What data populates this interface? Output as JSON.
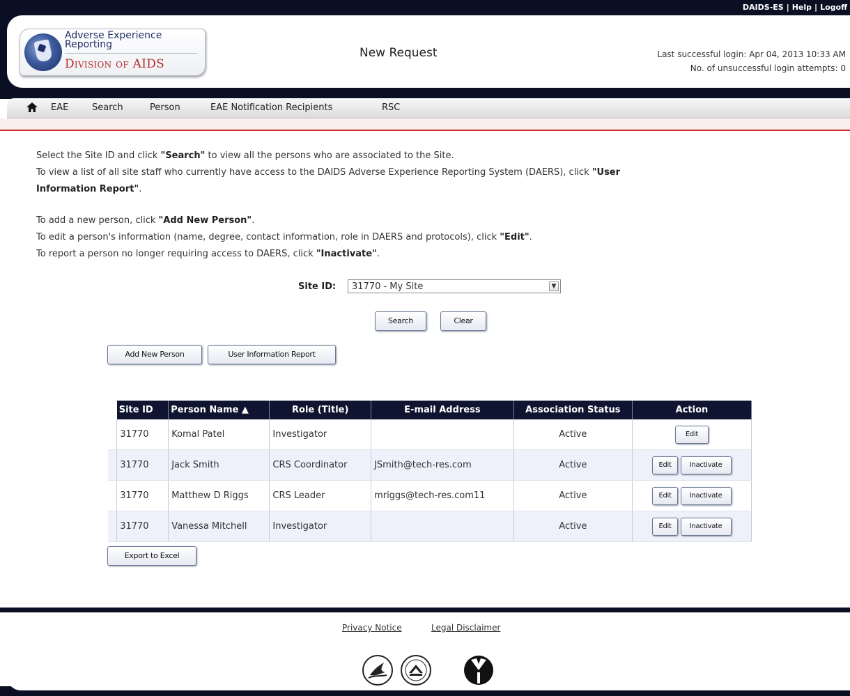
{
  "header": {
    "top_links": [
      "DAIDS-ES",
      "Help",
      "Logoff"
    ],
    "logo": {
      "line1": "Adverse Experience",
      "line2": "Reporting",
      "org": "Division of AIDS"
    },
    "page_title": "New Request",
    "last_login": "Last successful login: Apr 04, 2013 10:33 AM",
    "failed_attempts": "No. of unsuccessful login attempts: 0"
  },
  "nav": {
    "home_icon": "home-icon",
    "items": [
      "EAE",
      "Search",
      "Person",
      "EAE Notification Recipients",
      "RSC"
    ]
  },
  "instructions": {
    "line1_pre": "Select the Site ID and click ",
    "line1_bold": "\"Search\"",
    "line1_post": " to view all the persons who are associated to the Site.",
    "line2_pre": "To view a list of all site staff who currently have access to the DAIDS Adverse Experience Reporting System (DAERS), click ",
    "line2_bold": "\"User",
    "line3_bold": "Information Report\"",
    "line3_post": ".",
    "line4_pre": "To add a new person, click ",
    "line4_bold": "\"Add New Person\"",
    "line4_post": ".",
    "line5_pre": "To edit a person's information (name, degree, contact information, role in DAERS and protocols), click ",
    "line5_bold": "\"Edit\"",
    "line5_post": ".",
    "line6_pre": "To report a person no longer requiring access to DAERS, click ",
    "line6_bold": "\"Inactivate\"",
    "line6_post": "."
  },
  "form": {
    "site_label": "Site ID:",
    "site_value": "31770 - My Site",
    "search_label": "Search",
    "clear_label": "Clear",
    "add_person_label": "Add New Person",
    "user_report_label": "User Information Report"
  },
  "table": {
    "headers": [
      "Site ID",
      "Person Name ▲",
      "Role (Title)",
      "E-mail Address",
      "Association Status",
      "Action"
    ],
    "rows": [
      {
        "site": "31770",
        "name": "Komal Patel",
        "role": "Investigator",
        "email": "",
        "status": "Active",
        "actions": [
          "Edit"
        ]
      },
      {
        "site": "31770",
        "name": "Jack Smith",
        "role": "CRS Coordinator",
        "email": "JSmith@tech-res.com",
        "status": "Active",
        "actions": [
          "Edit",
          "Inactivate"
        ]
      },
      {
        "site": "31770",
        "name": "Matthew D Riggs",
        "role": "CRS Leader",
        "email": "mriggs@tech-res.com11",
        "status": "Active",
        "actions": [
          "Edit",
          "Inactivate"
        ]
      },
      {
        "site": "31770",
        "name": "Vanessa Mitchell",
        "role": "Investigator",
        "email": "",
        "status": "Active",
        "actions": [
          "Edit",
          "Inactivate"
        ]
      }
    ]
  },
  "export_label": "Export to Excel",
  "footer": {
    "privacy": "Privacy Notice",
    "legal": "Legal Disclaimer",
    "seals": [
      "hhs-seal-icon",
      "nih-seal-icon",
      "niaid-logo-icon"
    ]
  }
}
